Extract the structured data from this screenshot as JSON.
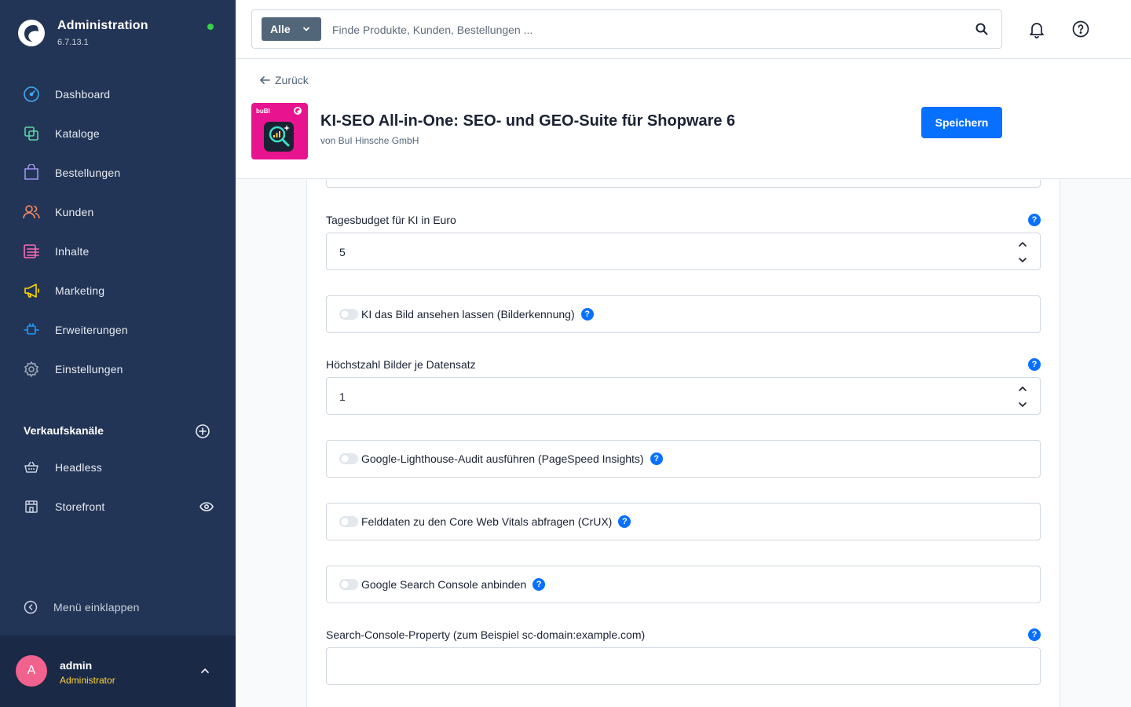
{
  "brand": {
    "title": "Administration",
    "version": "6.7.13.1",
    "status_color": "#37d046"
  },
  "nav": {
    "items": [
      {
        "label": "Dashboard",
        "icon": "dashboard-icon",
        "color": "#3fa9f5"
      },
      {
        "label": "Kataloge",
        "icon": "catalog-icon",
        "color": "#57d9a3"
      },
      {
        "label": "Bestellungen",
        "icon": "orders-icon",
        "color": "#a092f0"
      },
      {
        "label": "Kunden",
        "icon": "customers-icon",
        "color": "#f88962"
      },
      {
        "label": "Inhalte",
        "icon": "content-icon",
        "color": "#ff68b4"
      },
      {
        "label": "Marketing",
        "icon": "marketing-icon",
        "color": "#ffd700"
      },
      {
        "label": "Erweiterungen",
        "icon": "extensions-icon",
        "color": "#189eff"
      },
      {
        "label": "Einstellungen",
        "icon": "settings-icon",
        "color": "#9aa8b5"
      }
    ]
  },
  "channels": {
    "title": "Verkaufskanäle",
    "items": [
      {
        "label": "Headless"
      },
      {
        "label": "Storefront"
      }
    ]
  },
  "collapse_label": "Menü einklappen",
  "user": {
    "initial": "A",
    "name": "admin",
    "role": "Administrator"
  },
  "search": {
    "type": "Alle",
    "placeholder": "Finde Produkte, Kunden, Bestellungen ..."
  },
  "page": {
    "back_label": "Zurück",
    "plugin_title": "KI-SEO All-in-One: SEO- und GEO-Suite für Shopware 6",
    "plugin_vendor": "von BuI Hinsche GmbH",
    "save_label": "Speichern",
    "logo_text": "buBI"
  },
  "form": {
    "budget": {
      "label": "Tagesbudget für KI in Euro",
      "value": "5"
    },
    "image_recognition": {
      "label": "KI das Bild ansehen lassen (Bilderkennung)"
    },
    "max_images": {
      "label": "Höchstzahl Bilder je Datensatz",
      "value": "1"
    },
    "lighthouse": {
      "label": "Google-Lighthouse-Audit ausführen (PageSpeed Insights)"
    },
    "crux": {
      "label": "Felddaten zu den Core Web Vitals abfragen (CrUX)"
    },
    "gsc": {
      "label": "Google Search Console anbinden"
    },
    "gsc_property": {
      "label": "Search-Console-Property (zum Beispiel sc-domain:example.com)",
      "value": ""
    },
    "help_glyph": "?"
  },
  "colors": {
    "sidebar": "#233556",
    "accent": "#0870ff",
    "plugin_bg": "#e8138e",
    "avatar": "#f1628e",
    "role": "#ffd53d"
  }
}
